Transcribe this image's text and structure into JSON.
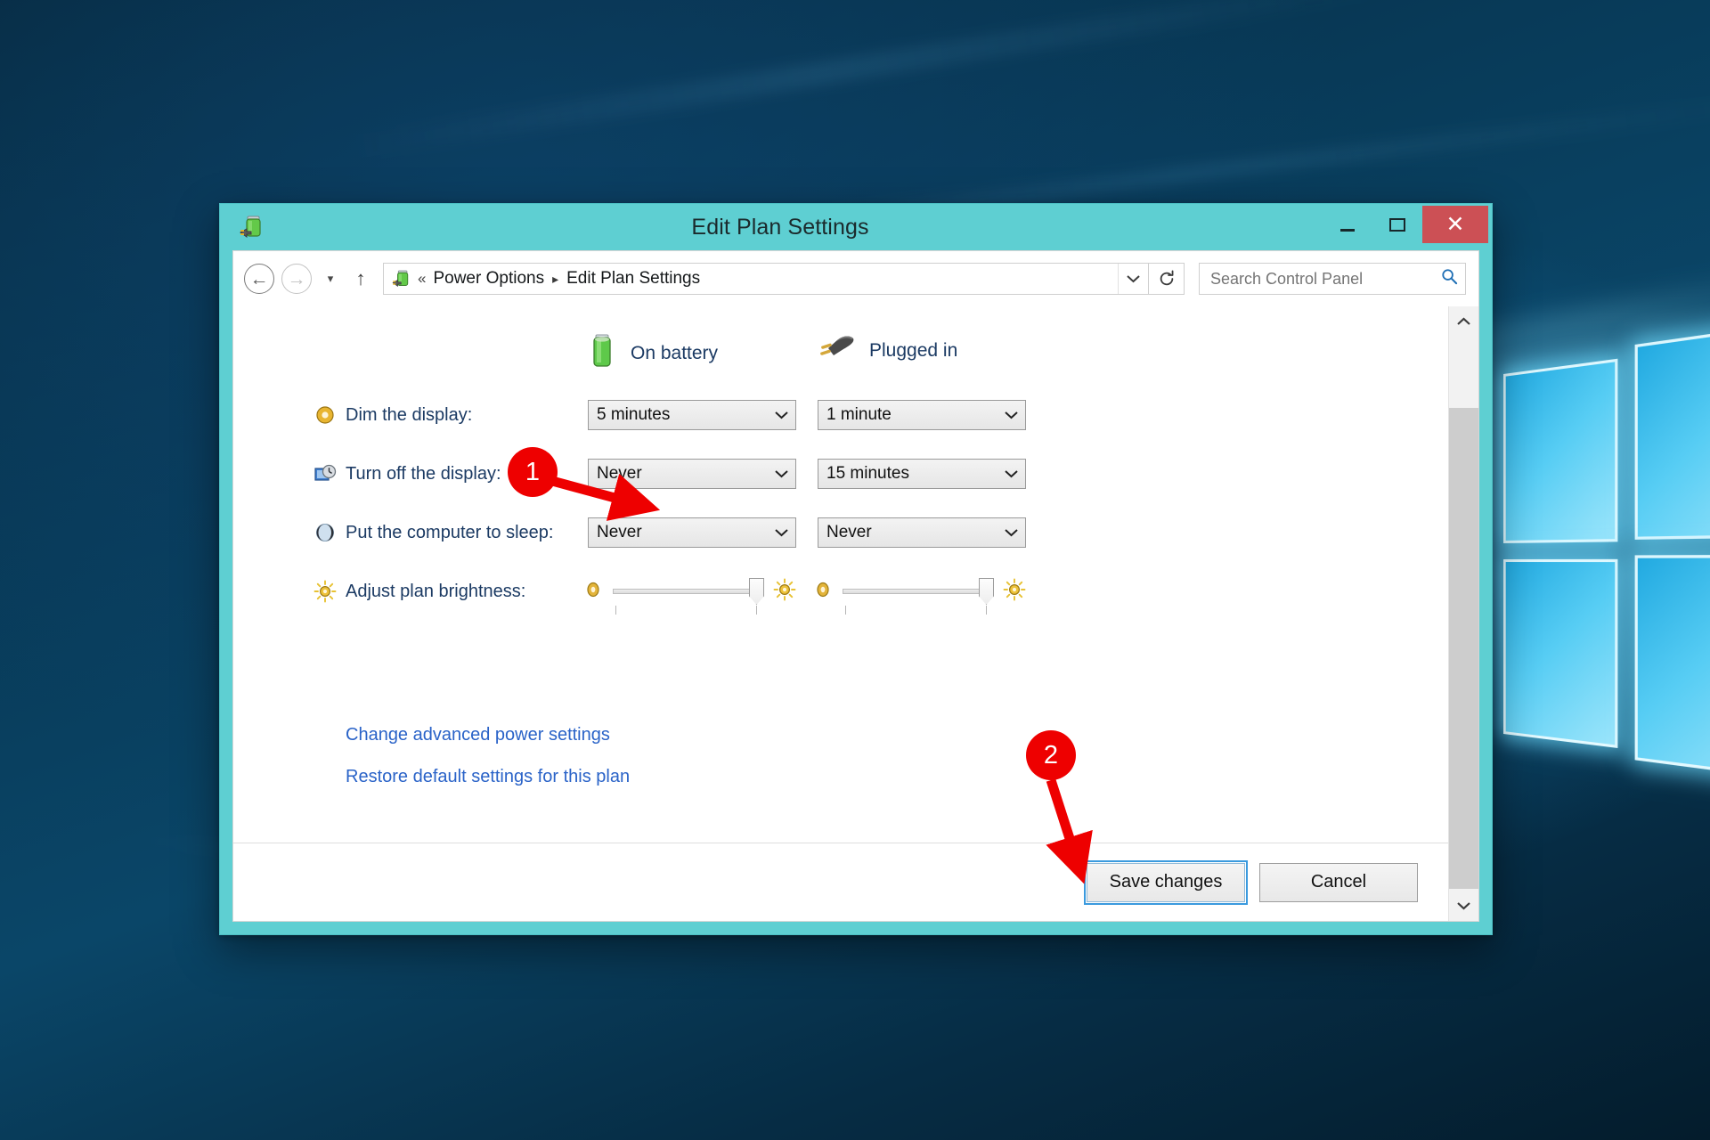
{
  "window": {
    "title": "Edit Plan Settings",
    "icon": "power-plan-icon",
    "controls": {
      "minimize": "–",
      "maximize": "□",
      "close": "✕"
    },
    "accent_color": "#5ecfd2",
    "close_color": "#cc5055"
  },
  "navbar": {
    "back": "←",
    "forward": "→",
    "recent": "▾",
    "up": "↑",
    "breadcrumb": {
      "overflow": "«",
      "items": [
        "Power Options",
        "Edit Plan Settings"
      ],
      "separator": "▸"
    },
    "address_dropdown": "⌄",
    "refresh": "↺"
  },
  "search": {
    "placeholder": "Search Control Panel",
    "value": "",
    "icon": "search-icon"
  },
  "columns": [
    {
      "label": "On battery",
      "icon": "battery-icon"
    },
    {
      "label": "Plugged in",
      "icon": "power-plug-icon"
    }
  ],
  "settings": [
    {
      "label": "Dim the display:",
      "icon": "dim-display-icon",
      "on_battery": "5 minutes",
      "plugged_in": "1 minute",
      "control": "dropdown"
    },
    {
      "label": "Turn off the display:",
      "icon": "turn-off-display-icon",
      "on_battery": "Never",
      "plugged_in": "15 minutes",
      "control": "dropdown"
    },
    {
      "label": "Put the computer to sleep:",
      "icon": "sleep-icon",
      "on_battery": "Never",
      "plugged_in": "Never",
      "control": "dropdown"
    },
    {
      "label": "Adjust plan brightness:",
      "icon": "brightness-icon",
      "on_battery": "90",
      "plugged_in": "90",
      "control": "slider"
    }
  ],
  "dropdown_arrow": "⌄",
  "links": [
    {
      "label": "Change advanced power settings"
    },
    {
      "label": "Restore default settings for this plan"
    }
  ],
  "buttons": {
    "save": "Save changes",
    "cancel": "Cancel"
  },
  "annotations": [
    {
      "number": "1",
      "target": "turn-off-display-on-battery-dropdown"
    },
    {
      "number": "2",
      "target": "save-changes-button"
    }
  ],
  "scrollbar": {
    "up": "⌃",
    "down": "⌄"
  }
}
